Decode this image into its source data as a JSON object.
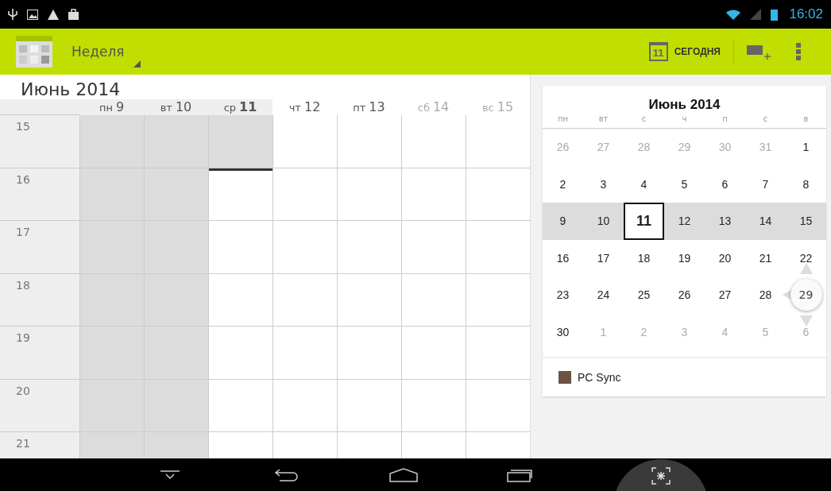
{
  "status_bar": {
    "time": "16:02"
  },
  "action_bar": {
    "view": "Неделя",
    "today_button": {
      "icon_day": "11",
      "label": "СЕГОДНЯ"
    }
  },
  "week_view": {
    "title": "Июнь 2014",
    "days": [
      {
        "label": "пн",
        "number": "9",
        "past": true,
        "today": false,
        "weekend": false
      },
      {
        "label": "вт",
        "number": "10",
        "past": true,
        "today": false,
        "weekend": false
      },
      {
        "label": "ср",
        "number": "11",
        "past": false,
        "today": true,
        "weekend": false
      },
      {
        "label": "чт",
        "number": "12",
        "past": false,
        "today": false,
        "weekend": false
      },
      {
        "label": "пт",
        "number": "13",
        "past": false,
        "today": false,
        "weekend": false
      },
      {
        "label": "сб",
        "number": "14",
        "past": false,
        "today": false,
        "weekend": true
      },
      {
        "label": "вс",
        "number": "15",
        "past": false,
        "today": false,
        "weekend": true
      }
    ],
    "hours": [
      "15",
      "16",
      "17",
      "18",
      "19",
      "20",
      "21"
    ]
  },
  "mini_calendar": {
    "title": "Июнь 2014",
    "weekdays": [
      "пн",
      "вт",
      "с",
      "ч",
      "п",
      "с",
      "в"
    ],
    "weeks": [
      {
        "selected": false,
        "days": [
          {
            "n": "26",
            "in_month": false,
            "today": false
          },
          {
            "n": "27",
            "in_month": false,
            "today": false
          },
          {
            "n": "28",
            "in_month": false,
            "today": false
          },
          {
            "n": "29",
            "in_month": false,
            "today": false
          },
          {
            "n": "30",
            "in_month": false,
            "today": false
          },
          {
            "n": "31",
            "in_month": false,
            "today": false
          },
          {
            "n": "1",
            "in_month": true,
            "today": false
          }
        ]
      },
      {
        "selected": false,
        "days": [
          {
            "n": "2",
            "in_month": true,
            "today": false
          },
          {
            "n": "3",
            "in_month": true,
            "today": false
          },
          {
            "n": "4",
            "in_month": true,
            "today": false
          },
          {
            "n": "5",
            "in_month": true,
            "today": false
          },
          {
            "n": "6",
            "in_month": true,
            "today": false
          },
          {
            "n": "7",
            "in_month": true,
            "today": false
          },
          {
            "n": "8",
            "in_month": true,
            "today": false
          }
        ]
      },
      {
        "selected": true,
        "days": [
          {
            "n": "9",
            "in_month": true,
            "today": false
          },
          {
            "n": "10",
            "in_month": true,
            "today": false
          },
          {
            "n": "11",
            "in_month": true,
            "today": true
          },
          {
            "n": "12",
            "in_month": true,
            "today": false
          },
          {
            "n": "13",
            "in_month": true,
            "today": false
          },
          {
            "n": "14",
            "in_month": true,
            "today": false
          },
          {
            "n": "15",
            "in_month": true,
            "today": false
          }
        ]
      },
      {
        "selected": false,
        "days": [
          {
            "n": "16",
            "in_month": true,
            "today": false
          },
          {
            "n": "17",
            "in_month": true,
            "today": false
          },
          {
            "n": "18",
            "in_month": true,
            "today": false
          },
          {
            "n": "19",
            "in_month": true,
            "today": false
          },
          {
            "n": "20",
            "in_month": true,
            "today": false
          },
          {
            "n": "21",
            "in_month": true,
            "today": false
          },
          {
            "n": "22",
            "in_month": true,
            "today": false
          }
        ]
      },
      {
        "selected": false,
        "days": [
          {
            "n": "23",
            "in_month": true,
            "today": false
          },
          {
            "n": "24",
            "in_month": true,
            "today": false
          },
          {
            "n": "25",
            "in_month": true,
            "today": false
          },
          {
            "n": "26",
            "in_month": true,
            "today": false
          },
          {
            "n": "27",
            "in_month": true,
            "today": false
          },
          {
            "n": "28",
            "in_month": true,
            "today": false
          },
          {
            "n": "29",
            "in_month": true,
            "today": false,
            "magnified": true
          }
        ]
      },
      {
        "selected": false,
        "days": [
          {
            "n": "30",
            "in_month": true,
            "today": false
          },
          {
            "n": "1",
            "in_month": false,
            "today": false
          },
          {
            "n": "2",
            "in_month": false,
            "today": false
          },
          {
            "n": "3",
            "in_month": false,
            "today": false
          },
          {
            "n": "4",
            "in_month": false,
            "today": false
          },
          {
            "n": "5",
            "in_month": false,
            "today": false
          },
          {
            "n": "6",
            "in_month": false,
            "today": false
          }
        ]
      }
    ],
    "calendars": [
      {
        "name": "PC Sync",
        "color": "#6b5444"
      }
    ]
  }
}
